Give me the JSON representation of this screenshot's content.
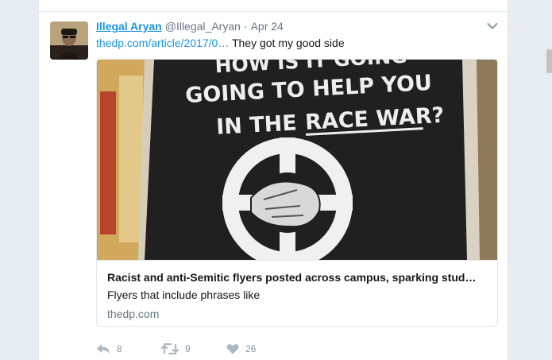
{
  "tweet": {
    "author": {
      "display_name": "Illegal Aryan",
      "handle": "@Illegal_Aryan"
    },
    "separator": "·",
    "timestamp": "Apr 24",
    "text": {
      "link": "thedp.com/article/2017/0…",
      "body": "They got my good side"
    },
    "card": {
      "image_text": {
        "line1": "HOW IS IT GOING",
        "line2": "GOING TO HELP YOU",
        "line3_prefix": "IN THE",
        "line3_emphasis": "RACE WAR?"
      },
      "title": "Racist and anti-Semitic flyers posted across campus, sparking stud…",
      "description": "Flyers that include phrases like",
      "domain": "thedp.com"
    },
    "actions": {
      "reply_count": "8",
      "retweet_count": "9",
      "like_count": "26"
    }
  },
  "colors": {
    "link": "#1b95e0",
    "secondary_text": "#657786",
    "action_icon": "#aab8c2",
    "page_background": "#e6ecf0"
  },
  "icons": [
    "caret-down-icon",
    "reply-icon",
    "retweet-icon",
    "heart-icon"
  ]
}
